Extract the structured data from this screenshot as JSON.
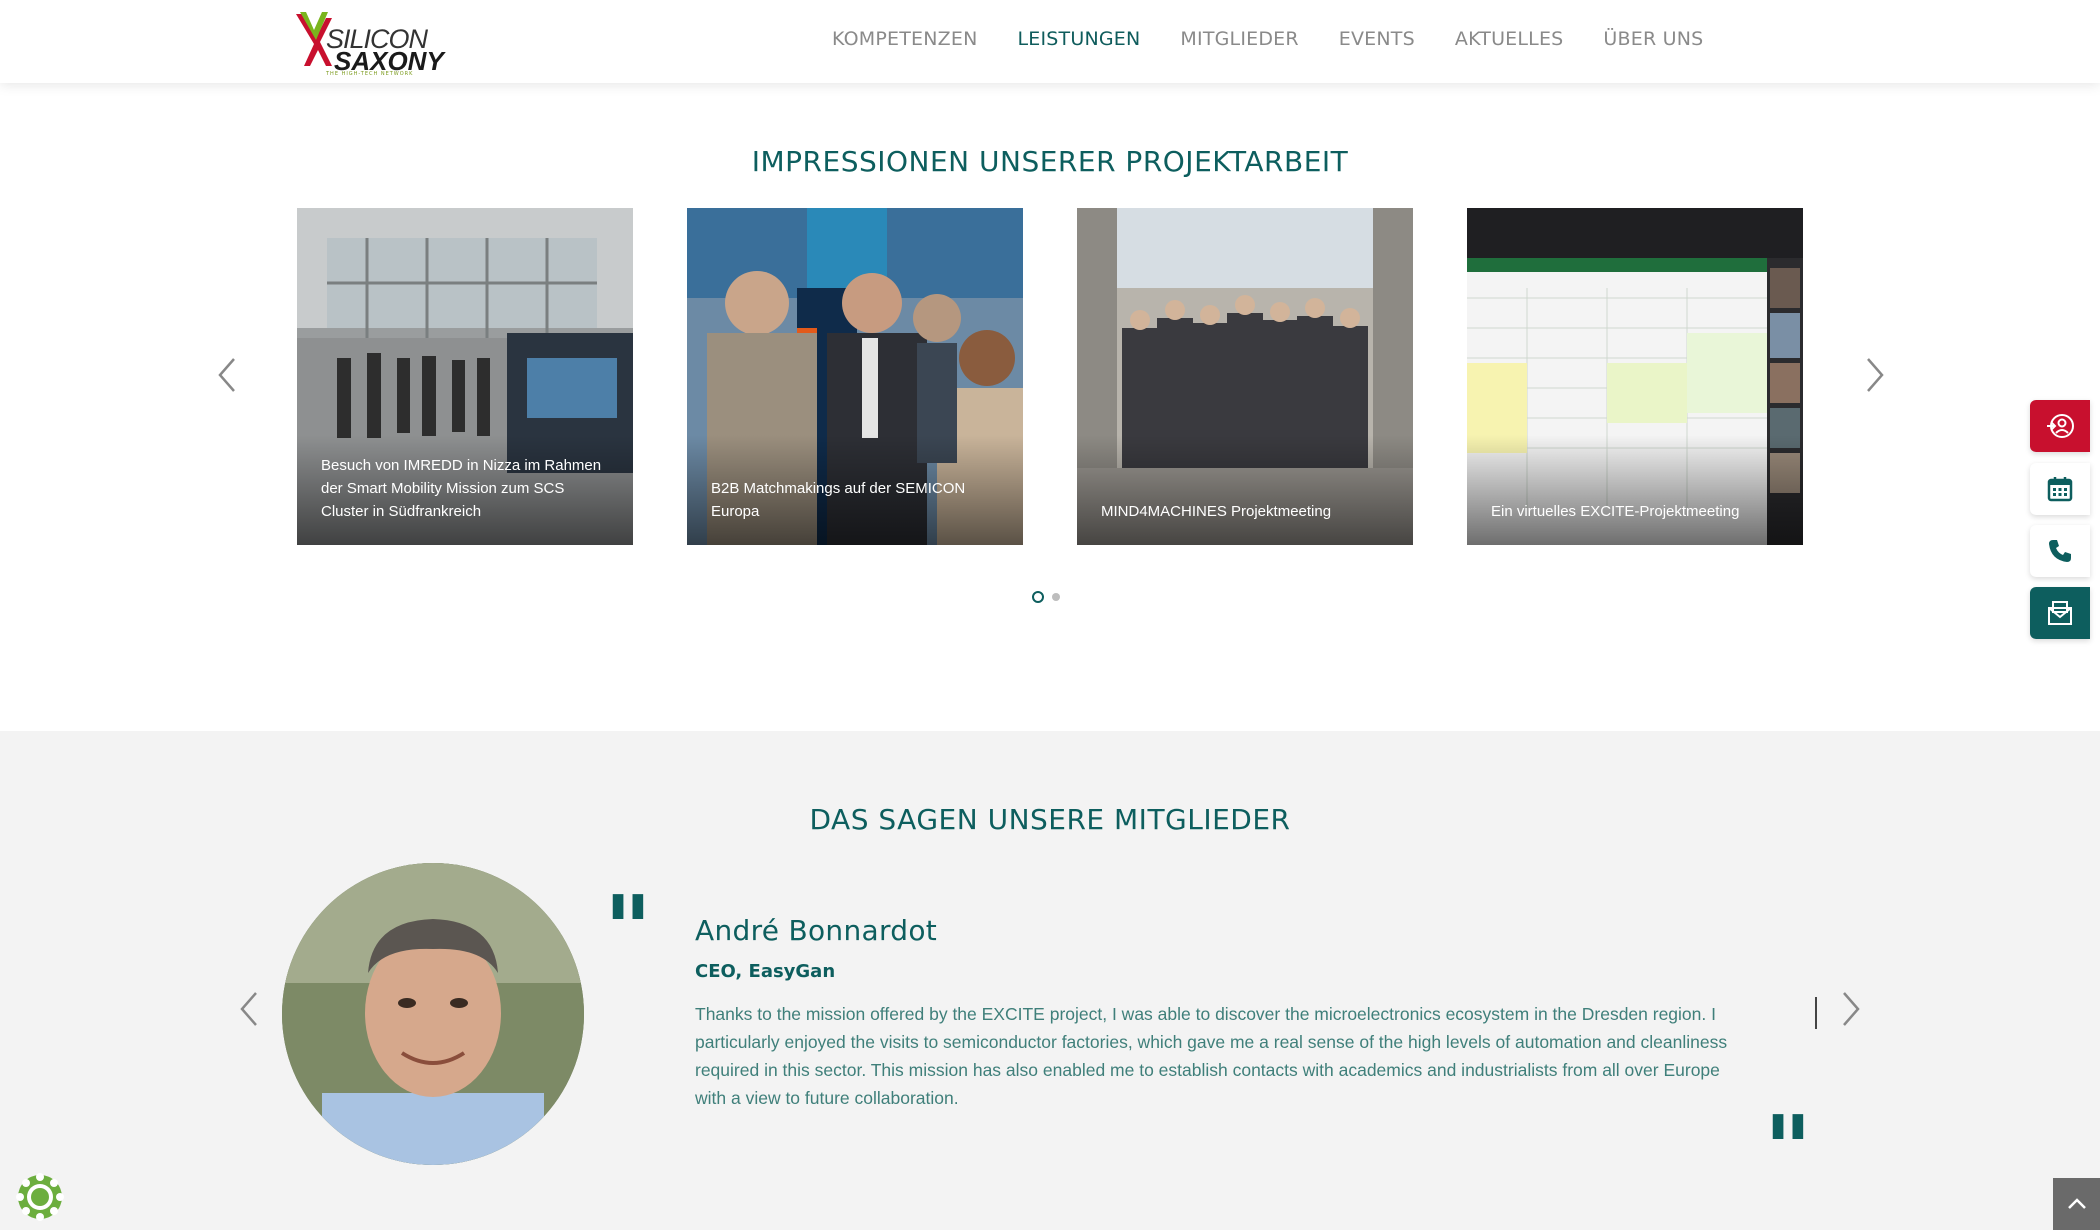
{
  "header": {
    "logo": {
      "line1": "SILICON",
      "line2": "SAXONY",
      "tagline": "THE HIGH-TECH NETWORK"
    },
    "nav": [
      {
        "label": "KOMPETENZEN",
        "active": false
      },
      {
        "label": "LEISTUNGEN",
        "active": true
      },
      {
        "label": "MITGLIEDER",
        "active": false
      },
      {
        "label": "EVENTS",
        "active": false
      },
      {
        "label": "AKTUELLES",
        "active": false
      },
      {
        "label": "ÜBER UNS",
        "active": false
      }
    ]
  },
  "projects": {
    "title": "IMPRESSIONEN UNSERER PROJEKTARBEIT",
    "cards": [
      {
        "caption": "Besuch von IMREDD in Nizza im Rahmen der Smart Mobility Mission zum SCS Cluster in Südfrankreich"
      },
      {
        "caption": "B2B Matchmakings auf der SEMICON Europa"
      },
      {
        "caption": "MIND4MACHINES Projektmeeting"
      },
      {
        "caption": "Ein virtuelles EXCITE-Projektmeeting"
      }
    ],
    "pagination": {
      "current": 1,
      "total": 2
    }
  },
  "testimonials": {
    "title": "DAS SAGEN UNSERE MITGLIEDER",
    "current": {
      "name": "André Bonnardot",
      "role": "CEO, EasyGan",
      "text": "Thanks to the mission offered by the EXCITE project, I was able to discover the microelectronics ecosystem in the Dresden region. I particularly enjoyed the visits to semiconductor factories, which gave me a real sense of the high levels of automation and cleanliness required in this sector. This mission has also enabled me to establish contacts with academics and industrialists from all over Europe with a view to future collaboration."
    }
  },
  "side_actions": [
    "login-icon",
    "calendar-icon",
    "phone-icon",
    "mail-icon"
  ],
  "colors": {
    "brand_teal": "#0d5e5e",
    "brand_red": "#c8102e",
    "brand_green": "#7a9a1a"
  }
}
